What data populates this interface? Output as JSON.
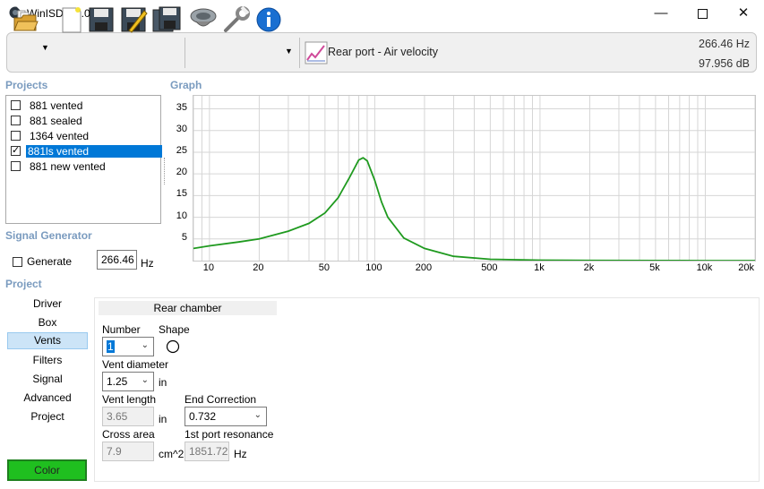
{
  "window": {
    "title": "WinISD 0.7.0.950"
  },
  "toolbar": {
    "mode_label": "Rear port - Air velocity",
    "readout_freq": "266.46 Hz",
    "readout_db": "97.956 dB"
  },
  "projects": {
    "header": "Projects",
    "items": [
      {
        "label": "881 vented",
        "checked": false,
        "selected": false
      },
      {
        "label": "881 sealed",
        "checked": false,
        "selected": false
      },
      {
        "label": "1364 vented",
        "checked": false,
        "selected": false
      },
      {
        "label": "881ls vented",
        "checked": true,
        "selected": true
      },
      {
        "label": "881 new vented",
        "checked": false,
        "selected": false
      }
    ]
  },
  "graph": {
    "header": "Graph"
  },
  "chart_data": {
    "type": "line",
    "x_scale": "log",
    "xlim": [
      8,
      20000
    ],
    "ylim": [
      0,
      38
    ],
    "y_ticks": [
      "5",
      "10",
      "15",
      "20",
      "25",
      "30",
      "35"
    ],
    "x_ticks": [
      "10",
      "20",
      "50",
      "100",
      "200",
      "500",
      "1k",
      "2k",
      "5k",
      "10k",
      "20k"
    ],
    "series": [
      {
        "color": "#1f9a1f",
        "x": [
          8,
          10,
          15,
          20,
          30,
          40,
          50,
          60,
          70,
          80,
          85,
          90,
          100,
          110,
          120,
          150,
          200,
          300,
          500,
          1000,
          2000,
          5000,
          10000,
          20000
        ],
        "y": [
          2.8,
          3.4,
          4.3,
          5.0,
          6.8,
          8.6,
          11.0,
          14.5,
          19.0,
          23.2,
          23.7,
          23.0,
          18.5,
          13.5,
          10.0,
          5.2,
          2.8,
          1.0,
          0.3,
          0.1,
          0.05,
          0.02,
          0.01,
          0.01
        ]
      }
    ]
  },
  "signal_generator": {
    "header": "Signal Generator",
    "generate_label": "Generate",
    "generate_checked": false,
    "frequency_value": "266.46",
    "frequency_unit": "Hz"
  },
  "project_section": {
    "header": "Project",
    "nav": [
      "Driver",
      "Box",
      "Vents",
      "Filters",
      "Signal",
      "Advanced",
      "Project"
    ],
    "active_nav": "Vents",
    "color_button": "Color"
  },
  "vents_panel": {
    "title": "Rear chamber",
    "number_label": "Number",
    "number_value": "1",
    "shape_label": "Shape",
    "diameter_label": "Vent diameter",
    "diameter_value": "1.25",
    "diameter_unit": "in",
    "length_label": "Vent length",
    "length_value": "3.65",
    "length_unit": "in",
    "end_correction_label": "End Correction",
    "end_correction_value": "0.732",
    "cross_area_label": "Cross area",
    "cross_area_value": "7.9",
    "cross_area_unit": "cm^2",
    "resonance_label": "1st port resonance",
    "resonance_value": "1851.72",
    "resonance_unit": "Hz"
  }
}
